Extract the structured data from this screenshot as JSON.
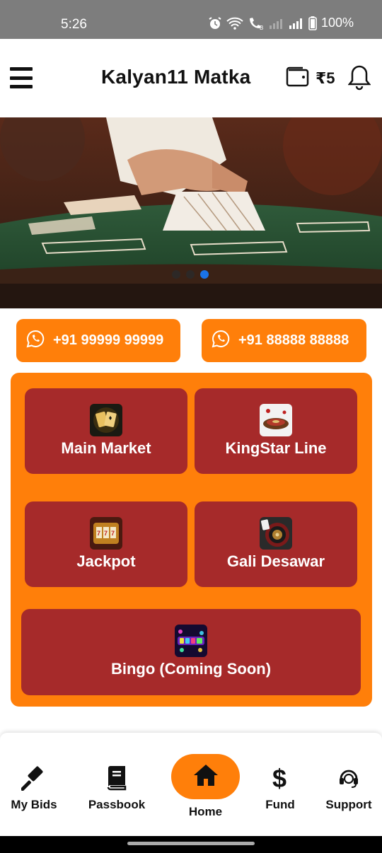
{
  "status_bar": {
    "time": "5:26",
    "battery": "100%"
  },
  "header": {
    "title": "Kalyan11 Matka",
    "wallet_amount": "₹5"
  },
  "banner": {
    "slides": 3,
    "active_slide": 3
  },
  "contacts": [
    {
      "label": "+91 99999 99999",
      "icon": "whatsapp-icon"
    },
    {
      "label": "+91 88888 88888",
      "icon": "whatsapp-icon"
    }
  ],
  "games": [
    {
      "label": "Main Market",
      "icon": "cards-icon"
    },
    {
      "label": "KingStar Line",
      "icon": "roulette-icon"
    },
    {
      "label": "Jackpot",
      "icon": "slot-machine-icon"
    },
    {
      "label": "Gali Desawar",
      "icon": "roulette-wheel-icon"
    },
    {
      "label": "Bingo (Coming Soon)",
      "icon": "bingo-icon"
    }
  ],
  "bottom_nav": [
    {
      "label": "My Bids",
      "icon": "gavel-icon"
    },
    {
      "label": "Passbook",
      "icon": "book-icon"
    },
    {
      "label": "Home",
      "icon": "home-icon",
      "active": true
    },
    {
      "label": "Fund",
      "icon": "dollar-icon"
    },
    {
      "label": "Support",
      "icon": "headset-icon"
    }
  ],
  "colors": {
    "accent": "#ff7f0a",
    "card": "#a62a2a",
    "status_bar": "#7d7d7d"
  }
}
